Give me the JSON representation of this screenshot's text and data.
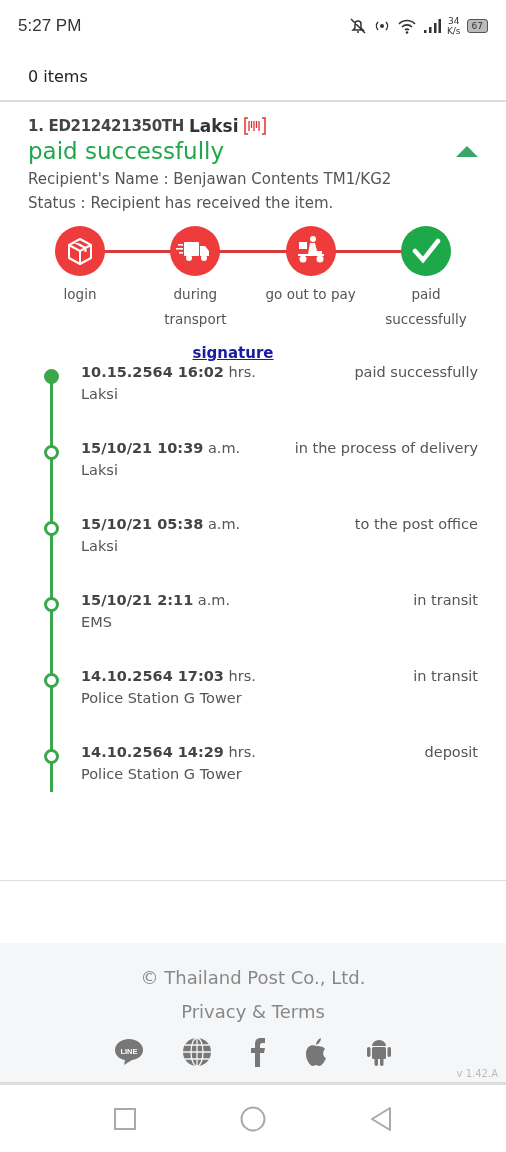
{
  "status_bar": {
    "time": "5:27 PM",
    "speed": "34",
    "speed_unit": "K/s",
    "battery": "67"
  },
  "header": {
    "title": "0 items"
  },
  "parcel": {
    "number": "1. ED212421350TH",
    "location": "Laksi",
    "status": "paid successfully",
    "expanded": true,
    "recipient": "Recipient's Name : Benjawan Contents TM1/KG2",
    "status_text": "Status : Recipient has received the item.",
    "steps": [
      {
        "kind": "box",
        "label": "login",
        "color": "#ee3b3b"
      },
      {
        "kind": "truck",
        "label": "during transport",
        "color": "#ee3b3b"
      },
      {
        "kind": "scooter",
        "label": "go out to pay",
        "color": "#ee3b3b"
      },
      {
        "kind": "check",
        "label": "paid successfully",
        "color": "#1fa84a"
      }
    ],
    "signature_link": "signature",
    "events": [
      {
        "time": "**10.15.2564 16:02** hrs.",
        "event": "paid successfully",
        "place": "Laksi",
        "current": true
      },
      {
        "time": "**15/10/21 10:39** a.m.",
        "event": "in the process of delivery",
        "place": "Laksi",
        "current": false
      },
      {
        "time": "**15/10/21 05:38** a.m.",
        "event": "to the post office",
        "place": "Laksi",
        "current": false
      },
      {
        "time": "**15/10/21 2:11** a.m.",
        "event": "in transit",
        "place": "EMS",
        "current": false
      },
      {
        "time": "**14.10.2564 17:03** hrs.",
        "event": "in transit",
        "place": "Police Station G Tower",
        "current": false
      },
      {
        "time": "**14.10.2564 14:29** hrs.",
        "event": "deposit",
        "place": "Police Station G Tower",
        "current": false
      }
    ]
  },
  "footer": {
    "copyright": "© Thailand Post Co., Ltd.",
    "links": "Privacy & Terms",
    "social": [
      {
        "kind": "line",
        "label": "LINE"
      },
      {
        "kind": "globe"
      },
      {
        "kind": "facebook"
      },
      {
        "kind": "apple"
      },
      {
        "kind": "android"
      }
    ],
    "version": "v 1.42.A"
  }
}
